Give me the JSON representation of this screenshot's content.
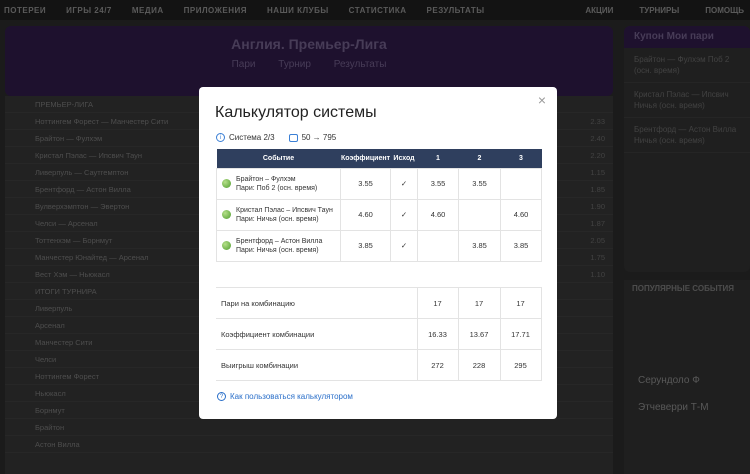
{
  "nav": {
    "items": [
      "ПОТЕРЕИ",
      "ИГРЫ 24/7",
      "МЕДИА",
      "ПРИЛОЖЕНИЯ",
      "НАШИ КЛУБЫ",
      "СТАТИСТИКА",
      "РЕЗУЛЬТАТЫ"
    ],
    "right": [
      "АКЦИИ",
      "ТУРНИРЫ",
      "ПОМОЩЬ"
    ]
  },
  "league": {
    "title": "Англия. Премьер-Лига",
    "tabs": [
      "Пари",
      "Турнир",
      "Результаты"
    ]
  },
  "background_rows": [
    {
      "text": "ПРЕМЬЕР-ЛИГА",
      "right": ""
    },
    {
      "text": "Ноттингем Форест — Манчестер Сити",
      "right": "2.33"
    },
    {
      "text": "Брайтон — Фулхэм",
      "right": "2.40"
    },
    {
      "text": "Кристал Пэлас — Ипсвич Таун",
      "right": "2.20"
    },
    {
      "text": "Ливерпуль — Саутгемптон",
      "right": "1.15"
    },
    {
      "text": "Брентфорд — Астон Вилла",
      "right": "1.85"
    },
    {
      "text": "Вулверхэмптон — Эвертон",
      "right": "1.90"
    },
    {
      "text": "Челси — Арсенал",
      "right": "1.87"
    },
    {
      "text": "Тоттенхэм — Борнмут",
      "right": "2.05"
    },
    {
      "text": "Манчестер Юнайтед — Арсенал",
      "right": "1.75"
    },
    {
      "text": "Вест Хэм — Ньюкасл",
      "right": "1.10"
    },
    {
      "text": "ИТОГИ ТУРНИРА",
      "right": ""
    },
    {
      "text": "Ливерпуль",
      "right": ""
    },
    {
      "text": "Арсенал",
      "right": ""
    },
    {
      "text": "Манчестер Сити",
      "right": ""
    },
    {
      "text": "Челси",
      "right": ""
    },
    {
      "text": "Ноттингем Форест",
      "right": ""
    },
    {
      "text": "Ньюкасл",
      "right": ""
    },
    {
      "text": "Борнмут",
      "right": ""
    },
    {
      "text": "Брайтон",
      "right": ""
    },
    {
      "text": "Астон Вилла",
      "right": ""
    }
  ],
  "coupon": {
    "header": "Купон   Мои пари",
    "items": [
      "Брайтон — Фулхэм Поб 2 (осн. время)",
      "Кристал Пэлас — Ипсвич Ничья (осн. время)",
      "Брентфорд — Астон Вилла Ничья (осн. время)"
    ]
  },
  "popular": {
    "header": "ПОПУЛЯРНЫЕ СОБЫТИЯ",
    "items": [
      "Серундоло Ф",
      "Этчеверри Т-М"
    ]
  },
  "modal": {
    "title": "Калькулятор системы",
    "close": "×",
    "system": "Система 2/3",
    "stake": "50 → 795",
    "headers": [
      "Событие",
      "Коэффициент",
      "Исход",
      "1",
      "2",
      "3"
    ],
    "events": [
      {
        "name": "Брайтон – Фулхэм",
        "bet": "Пари: Поб 2 (осн. время)",
        "coef": "3.55",
        "outcome": "✓",
        "c1": "3.55",
        "c2": "3.55",
        "c3": ""
      },
      {
        "name": "Кристал Пэлас – Ипсвич Таун",
        "bet": "Пари: Ничья (осн. время)",
        "coef": "4.60",
        "outcome": "✓",
        "c1": "4.60",
        "c2": "",
        "c3": "4.60"
      },
      {
        "name": "Брентфорд – Астон Вилла",
        "bet": "Пари: Ничья (осн. время)",
        "coef": "3.85",
        "outcome": "✓",
        "c1": "",
        "c2": "3.85",
        "c3": "3.85"
      }
    ],
    "summary": [
      {
        "label": "Пари на комбинацию",
        "v1": "17",
        "v2": "17",
        "v3": "17"
      },
      {
        "label": "Коэффициент комбинации",
        "v1": "16.33",
        "v2": "13.67",
        "v3": "17.71"
      },
      {
        "label": "Выигрыш комбинации",
        "v1": "272",
        "v2": "228",
        "v3": "295"
      }
    ],
    "help": "Как пользоваться калькулятором"
  }
}
